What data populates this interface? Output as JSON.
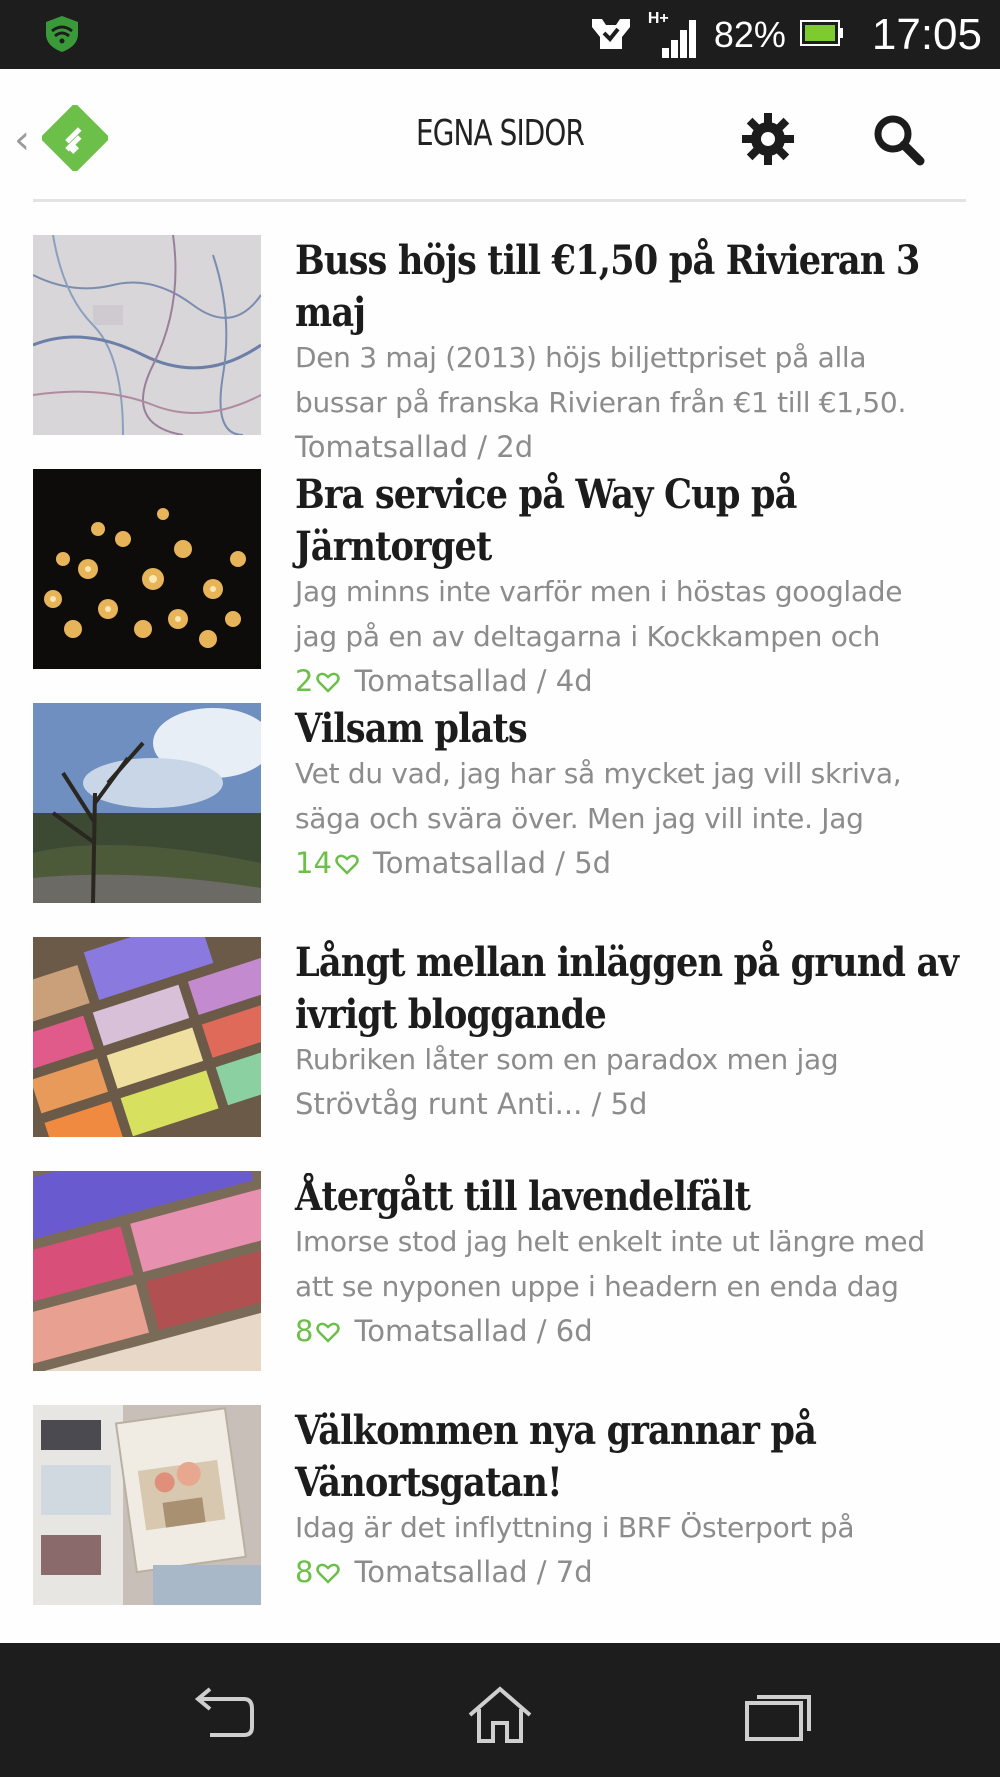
{
  "status_bar": {
    "battery_percent": "82%",
    "clock": "17:05",
    "network": "H+",
    "icons": [
      "shield-wifi-icon",
      "notification-icon",
      "signal-icon",
      "battery-icon"
    ]
  },
  "header": {
    "title": "EGNA SIDOR",
    "accent_color": "#6cc04a",
    "icons": [
      "feedly-logo",
      "gear-icon",
      "search-icon"
    ]
  },
  "feed": {
    "items": [
      {
        "title": "Buss höjs till €1,50 på Rivieran 3 maj",
        "snippet": [
          "Den 3 maj (2013) höjs biljettpriset på alla",
          "bussar på franska Rivieran från €1 till €1,50."
        ],
        "likes": "",
        "source_age": "Tomatsallad / 2d",
        "thumb": "map"
      },
      {
        "title": "Bra service på Way Cup på Järntorget",
        "snippet": [
          "Jag minns inte varför men i höstas googlade",
          "jag på en av deltagarna i Kockkampen och"
        ],
        "likes": "2",
        "source_age": "Tomatsallad / 4d",
        "thumb": "lanterns"
      },
      {
        "title": "Vilsam plats",
        "snippet": [
          "Vet du vad, jag har så mycket jag vill skriva,",
          "säga och svära över. Men jag vill inte. Jag"
        ],
        "likes": "14",
        "source_age": "Tomatsallad / 5d",
        "thumb": "landscape"
      },
      {
        "title": "Långt mellan inläggen på grund av ivrigt bloggande",
        "snippet": [
          "Rubriken låter som en paradox men jag"
        ],
        "likes": "",
        "source_age": "Strövtåg runt Anti... / 5d",
        "thumb": "soap1"
      },
      {
        "title": "Återgått till lavendelfält",
        "snippet": [
          "Imorse stod jag helt enkelt inte ut längre med",
          "att se nyponen uppe i headern en enda dag"
        ],
        "likes": "8",
        "source_age": "Tomatsallad / 6d",
        "thumb": "soap2"
      },
      {
        "title": "Välkommen nya grannar på Vänortsgatan!",
        "snippet": [
          "Idag är det inflyttning i BRF Österport på"
        ],
        "likes": "8",
        "source_age": "Tomatsallad / 7d",
        "thumb": "magazines"
      }
    ]
  },
  "nav_bar": {
    "icons": [
      "back-icon",
      "home-icon",
      "recent-apps-icon"
    ]
  }
}
